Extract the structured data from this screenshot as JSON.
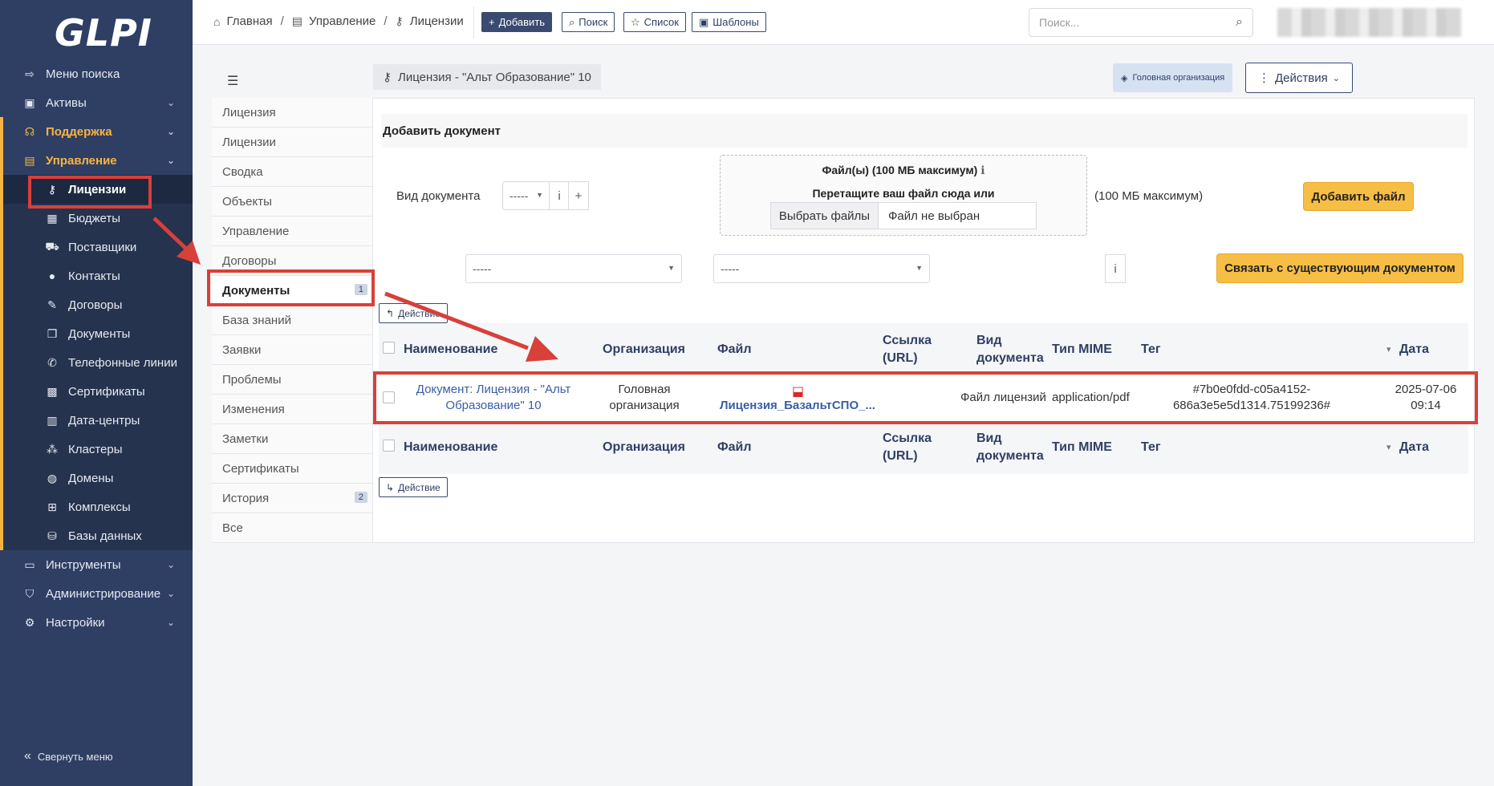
{
  "sidebar": {
    "logo": "GLPI",
    "items": [
      {
        "label": "Меню поиска",
        "icon": "arrow-right-icon"
      },
      {
        "label": "Активы",
        "icon": "box-icon",
        "chev": "⌄"
      },
      {
        "label": "Поддержка",
        "icon": "headset-icon",
        "chev": "⌄"
      },
      {
        "label": "Управление",
        "icon": "wallet-icon",
        "chev": "⌄"
      }
    ],
    "sub_items": [
      {
        "label": "Лицензии",
        "icon": "key-icon"
      },
      {
        "label": "Бюджеты",
        "icon": "calculator-icon"
      },
      {
        "label": "Поставщики",
        "icon": "truck-icon"
      },
      {
        "label": "Контакты",
        "icon": "user-icon"
      },
      {
        "label": "Договоры",
        "icon": "signature-icon"
      },
      {
        "label": "Документы",
        "icon": "documents-icon"
      },
      {
        "label": "Телефонные линии",
        "icon": "phone-icon"
      },
      {
        "label": "Сертификаты",
        "icon": "certificate-icon"
      },
      {
        "label": "Дата-центры",
        "icon": "building-icon"
      },
      {
        "label": "Кластеры",
        "icon": "cluster-icon"
      },
      {
        "label": "Домены",
        "icon": "globe-icon"
      },
      {
        "label": "Комплексы",
        "icon": "apps-icon"
      },
      {
        "label": "Базы данных",
        "icon": "database-icon"
      }
    ],
    "bottom_items": [
      {
        "label": "Инструменты",
        "icon": "briefcase-icon",
        "chev": "⌄"
      },
      {
        "label": "Администрирование",
        "icon": "shield-icon",
        "chev": "⌄"
      },
      {
        "label": "Настройки",
        "icon": "gear-icon",
        "chev": "⌄"
      }
    ],
    "collapse": "Свернуть меню"
  },
  "topbar": {
    "crumbs": [
      "Главная",
      "Управление",
      "Лицензии"
    ],
    "sep": "/",
    "buttons": [
      "Добавить",
      "Поиск",
      "Список",
      "Шаблоны"
    ],
    "search_placeholder": "Поиск..."
  },
  "main": {
    "title": "Лицензия - \"Альт Образование\" 10",
    "entity": "Головная организация",
    "actions": "Действия"
  },
  "tabs": [
    {
      "label": "Лицензия"
    },
    {
      "label": "Лицензии"
    },
    {
      "label": "Сводка"
    },
    {
      "label": "Объекты"
    },
    {
      "label": "Управление"
    },
    {
      "label": "Договоры"
    },
    {
      "label": "Документы",
      "badge": "1"
    },
    {
      "label": "База знаний"
    },
    {
      "label": "Заявки"
    },
    {
      "label": "Проблемы"
    },
    {
      "label": "Изменения"
    },
    {
      "label": "Заметки"
    },
    {
      "label": "Сертификаты"
    },
    {
      "label": "История",
      "badge": "2"
    },
    {
      "label": "Все"
    }
  ],
  "form": {
    "heading": "Добавить документ",
    "doc_type_label": "Вид документа",
    "doc_type_value": "-----",
    "info": "i",
    "plus": "+",
    "dz_title": "Файл(ы) (100 МБ максимум)",
    "dz_sub": "Перетащите ваш файл сюда или",
    "pick": "Выбрать файлы",
    "no_file": "Файл не выбран",
    "max_note": "(100 МБ максимум)",
    "add_file": "Добавить файл",
    "select1": "-----",
    "select2": "-----",
    "link_existing": "Связать с существующим документом"
  },
  "table": {
    "action": "Действие",
    "headers": [
      "Наименование",
      "Организация",
      "Файл",
      "Ссылка (URL)",
      "Вид документа",
      "Тип MIME",
      "Тег",
      "Дата"
    ],
    "sort_indicator": "▾",
    "row": {
      "name": "Документ: Лицензия - \"Альт Образование\" 10",
      "org": "Головная организация",
      "file": "Лицензия_БазальтСПО_...",
      "url": "",
      "doc_type": "Файл лицензий",
      "mime": "application/pdf",
      "tag": "#7b0e0fdd-c05a4152-686a3e5e5d1314.75199236#",
      "date": "2025-07-06 09:14"
    }
  },
  "colors": {
    "sidebar": "#2f3f64",
    "accent": "#f7b440",
    "annotation": "#d8403a",
    "link": "#3a5da8"
  }
}
